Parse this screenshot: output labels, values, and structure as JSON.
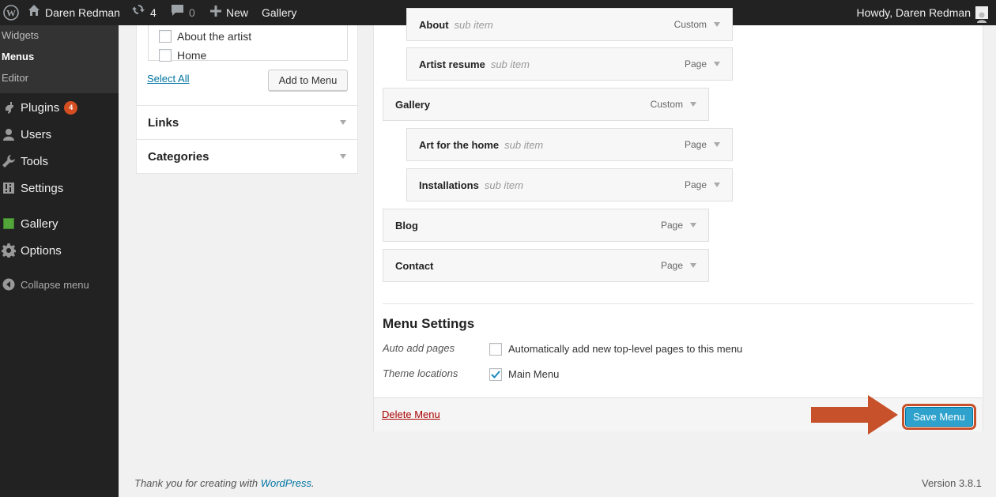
{
  "admin_bar": {
    "site_name": "Daren Redman",
    "updates_count": "4",
    "comments_count": "0",
    "new_label": "New",
    "gallery_label": "Gallery",
    "howdy": "Howdy, Daren Redman"
  },
  "sidebar": {
    "submenu": [
      {
        "label": "Widgets"
      },
      {
        "label": "Menus"
      },
      {
        "label": "Editor"
      }
    ],
    "items": [
      {
        "label": "Plugins",
        "badge": "4",
        "icon": "plugin-icon"
      },
      {
        "label": "Users",
        "icon": "users-icon"
      },
      {
        "label": "Tools",
        "icon": "tools-icon"
      },
      {
        "label": "Settings",
        "icon": "settings-icon"
      },
      {
        "label": "Gallery",
        "icon": "gallery-icon"
      },
      {
        "label": "Options",
        "icon": "gear-icon"
      }
    ],
    "collapse_label": "Collapse menu"
  },
  "pages_box": {
    "items": [
      {
        "label": "About the artist",
        "checked": false
      },
      {
        "label": "Home",
        "checked": false
      }
    ],
    "select_all": "Select All",
    "add_button": "Add to Menu",
    "sections": [
      {
        "label": "Links"
      },
      {
        "label": "Categories"
      }
    ]
  },
  "menu_structure": {
    "items": [
      {
        "title": "About",
        "sub": "sub item",
        "type": "Custom",
        "depth": 1
      },
      {
        "title": "Artist resume",
        "sub": "sub item",
        "type": "Page",
        "depth": 1
      },
      {
        "title": "Gallery",
        "sub": "",
        "type": "Custom",
        "depth": 0
      },
      {
        "title": "Art for the home",
        "sub": "sub item",
        "type": "Page",
        "depth": 1
      },
      {
        "title": "Installations",
        "sub": "sub item",
        "type": "Page",
        "depth": 1
      },
      {
        "title": "Blog",
        "sub": "",
        "type": "Page",
        "depth": 0
      },
      {
        "title": "Contact",
        "sub": "",
        "type": "Page",
        "depth": 0
      }
    ]
  },
  "menu_settings": {
    "title": "Menu Settings",
    "auto_add_label": "Auto add pages",
    "auto_add_option": "Automatically add new top-level pages to this menu",
    "auto_add_checked": false,
    "theme_locations_label": "Theme locations",
    "main_menu_option": "Main Menu",
    "main_menu_checked": true
  },
  "actions": {
    "delete_label": "Delete Menu",
    "save_label": "Save Menu"
  },
  "footer": {
    "thanks_prefix": "Thank you for creating with ",
    "thanks_link": "WordPress",
    "thanks_suffix": ".",
    "version": "Version 3.8.1"
  },
  "colors": {
    "admin_bg": "#222222",
    "accent_blue": "#2ea2cc",
    "badge_orange": "#d54e21",
    "annotation_arrow": "#c7512a"
  }
}
